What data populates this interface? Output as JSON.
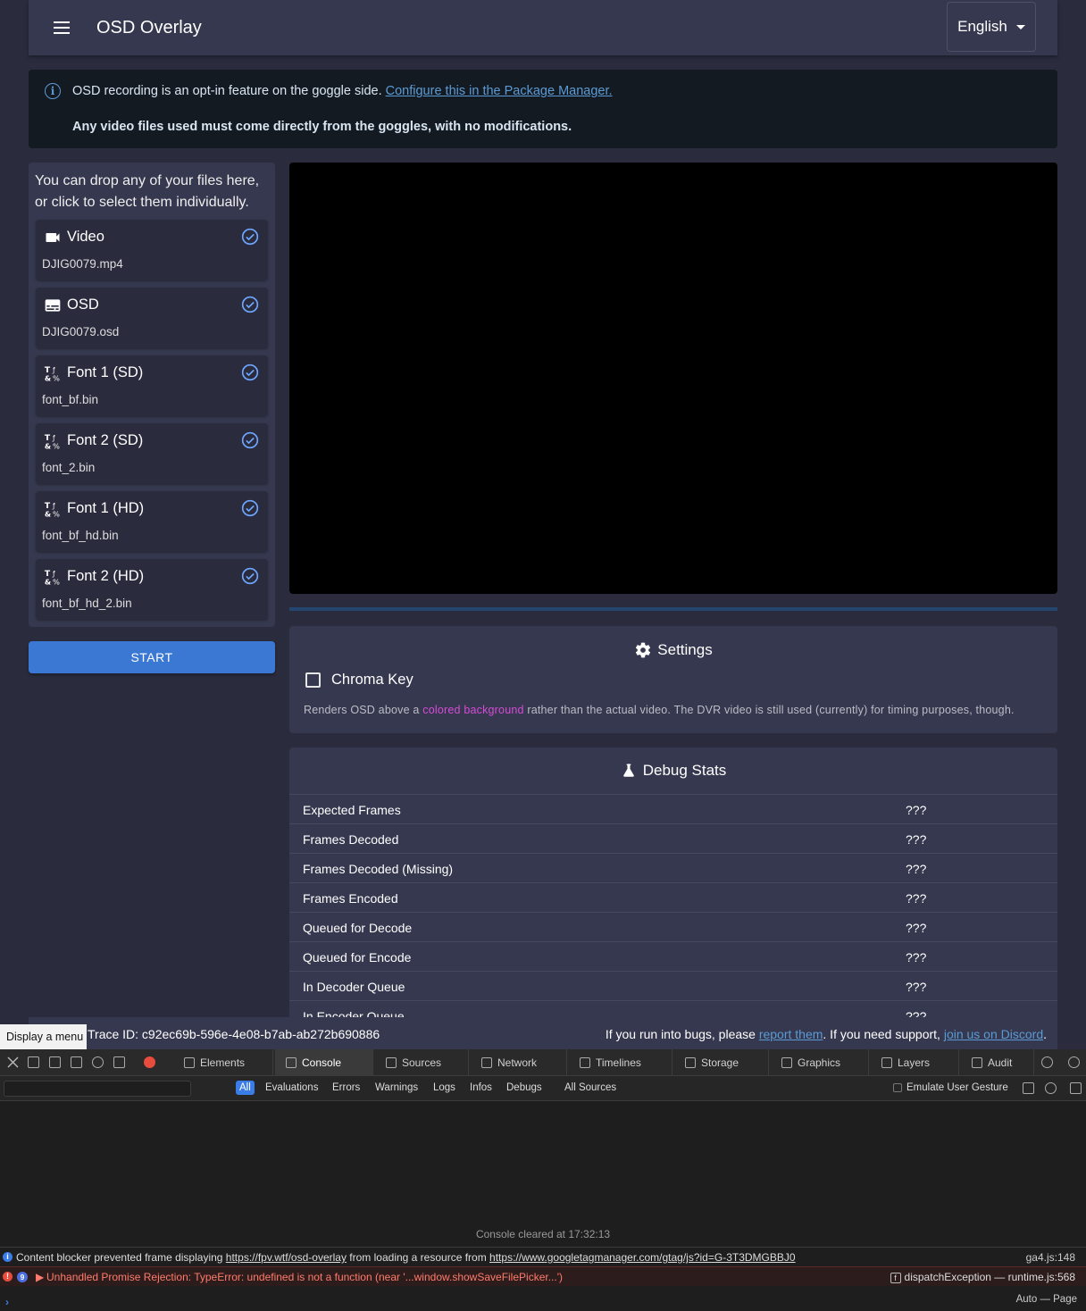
{
  "app_bar": {
    "title": "OSD Overlay",
    "language": "English"
  },
  "alert": {
    "text": "OSD recording is an opt-in feature on the goggle side. ",
    "link": "Configure this in the Package Manager.",
    "warning": "Any video files used must come directly from the goggles, with no modifications."
  },
  "files": {
    "hint": "You can drop any of your files here, or click to select them individually.",
    "items": [
      {
        "label": "Video",
        "file": "DJIG0079.mp4",
        "icon": "video-camera-icon"
      },
      {
        "label": "OSD",
        "file": "DJIG0079.osd",
        "icon": "subtitles-icon"
      },
      {
        "label": "Font 1 (SD)",
        "file": "font_bf.bin",
        "icon": "font-glyphs-icon"
      },
      {
        "label": "Font 2 (SD)",
        "file": "font_2.bin",
        "icon": "font-glyphs-icon"
      },
      {
        "label": "Font 1 (HD)",
        "file": "font_bf_hd.bin",
        "icon": "font-glyphs-icon"
      },
      {
        "label": "Font 2 (HD)",
        "file": "font_bf_hd_2.bin",
        "icon": "font-glyphs-icon"
      }
    ]
  },
  "start_label": "START",
  "progress": {
    "value": 0
  },
  "settings": {
    "title": "Settings",
    "chroma_label": "Chroma Key",
    "chroma_desc_pre": "Renders OSD above a ",
    "chroma_desc_hl": "colored background",
    "chroma_desc_post": " rather than the actual video. The DVR video is still used (currently) for timing purposes, though."
  },
  "debug": {
    "title": "Debug Stats",
    "rows": [
      {
        "k": "Expected Frames",
        "v": "???"
      },
      {
        "k": "Frames Decoded",
        "v": "???"
      },
      {
        "k": "Frames Decoded (Missing)",
        "v": "???"
      },
      {
        "k": "Frames Encoded",
        "v": "???"
      },
      {
        "k": "Queued for Decode",
        "v": "???"
      },
      {
        "k": "Queued for Encode",
        "v": "???"
      },
      {
        "k": "In Decoder Queue",
        "v": "???"
      },
      {
        "k": "In Encoder Queue",
        "v": "???"
      }
    ]
  },
  "footer": {
    "trace": "Trace ID: c92ec69b-596e-4e08-b7ab-ab272b690886",
    "support_pre": "If you run into bugs, please ",
    "report_link": "report them",
    "support_mid": ". If you need support, ",
    "discord_link": "join us on Discord",
    "support_post": "."
  },
  "tooltip": "Display a menu",
  "devtools": {
    "tabs": [
      "Elements",
      "Console",
      "Sources",
      "Network",
      "Timelines",
      "Storage",
      "Graphics",
      "Layers",
      "Audit"
    ],
    "filters": [
      "All",
      "Evaluations",
      "Errors",
      "Warnings",
      "Logs",
      "Infos",
      "Debugs",
      "All Sources"
    ],
    "emulate": "Emulate User Gesture",
    "cleared": "Console cleared at 17:32:13",
    "info_msg": {
      "pre": "Content blocker prevented frame displaying ",
      "url1": "https://fpv.wtf/osd-overlay",
      "mid": " from loading a resource from ",
      "url2": "https://www.googletagmanager.com/gtag/js?id=G-3T3DMGBBJ0",
      "src": "ga4.js:148"
    },
    "err_msg": {
      "count": "9",
      "text": "Unhandled Promise Rejection: TypeError: undefined is not a function (near '...window.showSaveFilePicker...')",
      "fn": "dispatchException",
      "src": "runtime.js:568"
    },
    "page_sel": "Auto — Page"
  },
  "colors": {
    "accent": "#3a78d4",
    "panel": "#35384e",
    "background": "#2a2c3e",
    "highlight": "#d74bd8"
  }
}
